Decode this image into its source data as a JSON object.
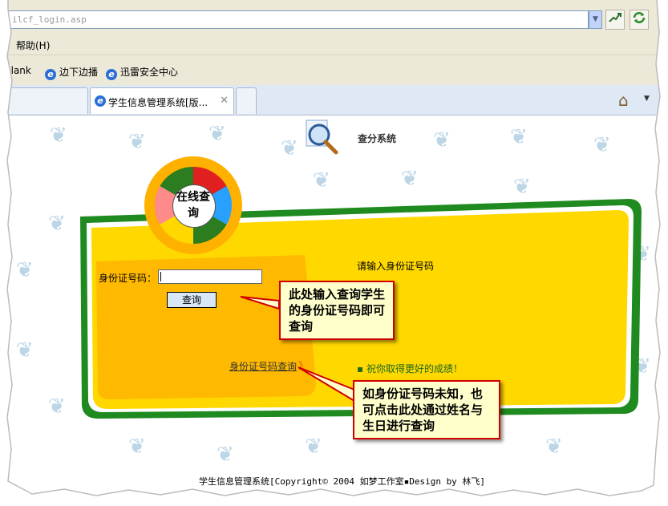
{
  "browser": {
    "address": "ilcf_login.asp",
    "menu": [
      "帮助(H)"
    ],
    "favorites": [
      "blank",
      "边下边播",
      "迅雷安全中心"
    ],
    "tabs": [
      {
        "title": ""
      },
      {
        "title": "学生信息管理系统[版..."
      }
    ],
    "icons": [
      "go-icon",
      "refresh-icon",
      "home-icon",
      "ie-icon"
    ]
  },
  "page": {
    "system_title": "查分系统",
    "logo_text": "在线查询",
    "form": {
      "label": "身份证号码：",
      "input_value": "",
      "query_button": "查询",
      "hint": "请输入身份证号码"
    },
    "lookup_link": "身份证号码查询",
    "lookup_arrow": "》",
    "wish": "▪ 祝你取得更好的成绩！",
    "copyright": "学生信息管理系统[Copyright© 2004 如梦工作室▪Design by 林飞]"
  },
  "callouts": [
    {
      "text": "此处输入查询学生的身份证号码即可查询"
    },
    {
      "text": "如身份证号码未知，也可点击此处通过姓名与生日进行查询"
    }
  ],
  "colors": {
    "board_yellow": "#ffd800",
    "board_green": "#1f8a1f",
    "panel_orange": "#ffb400",
    "callout_bg": "#ffffcc",
    "callout_border": "#d00000"
  }
}
